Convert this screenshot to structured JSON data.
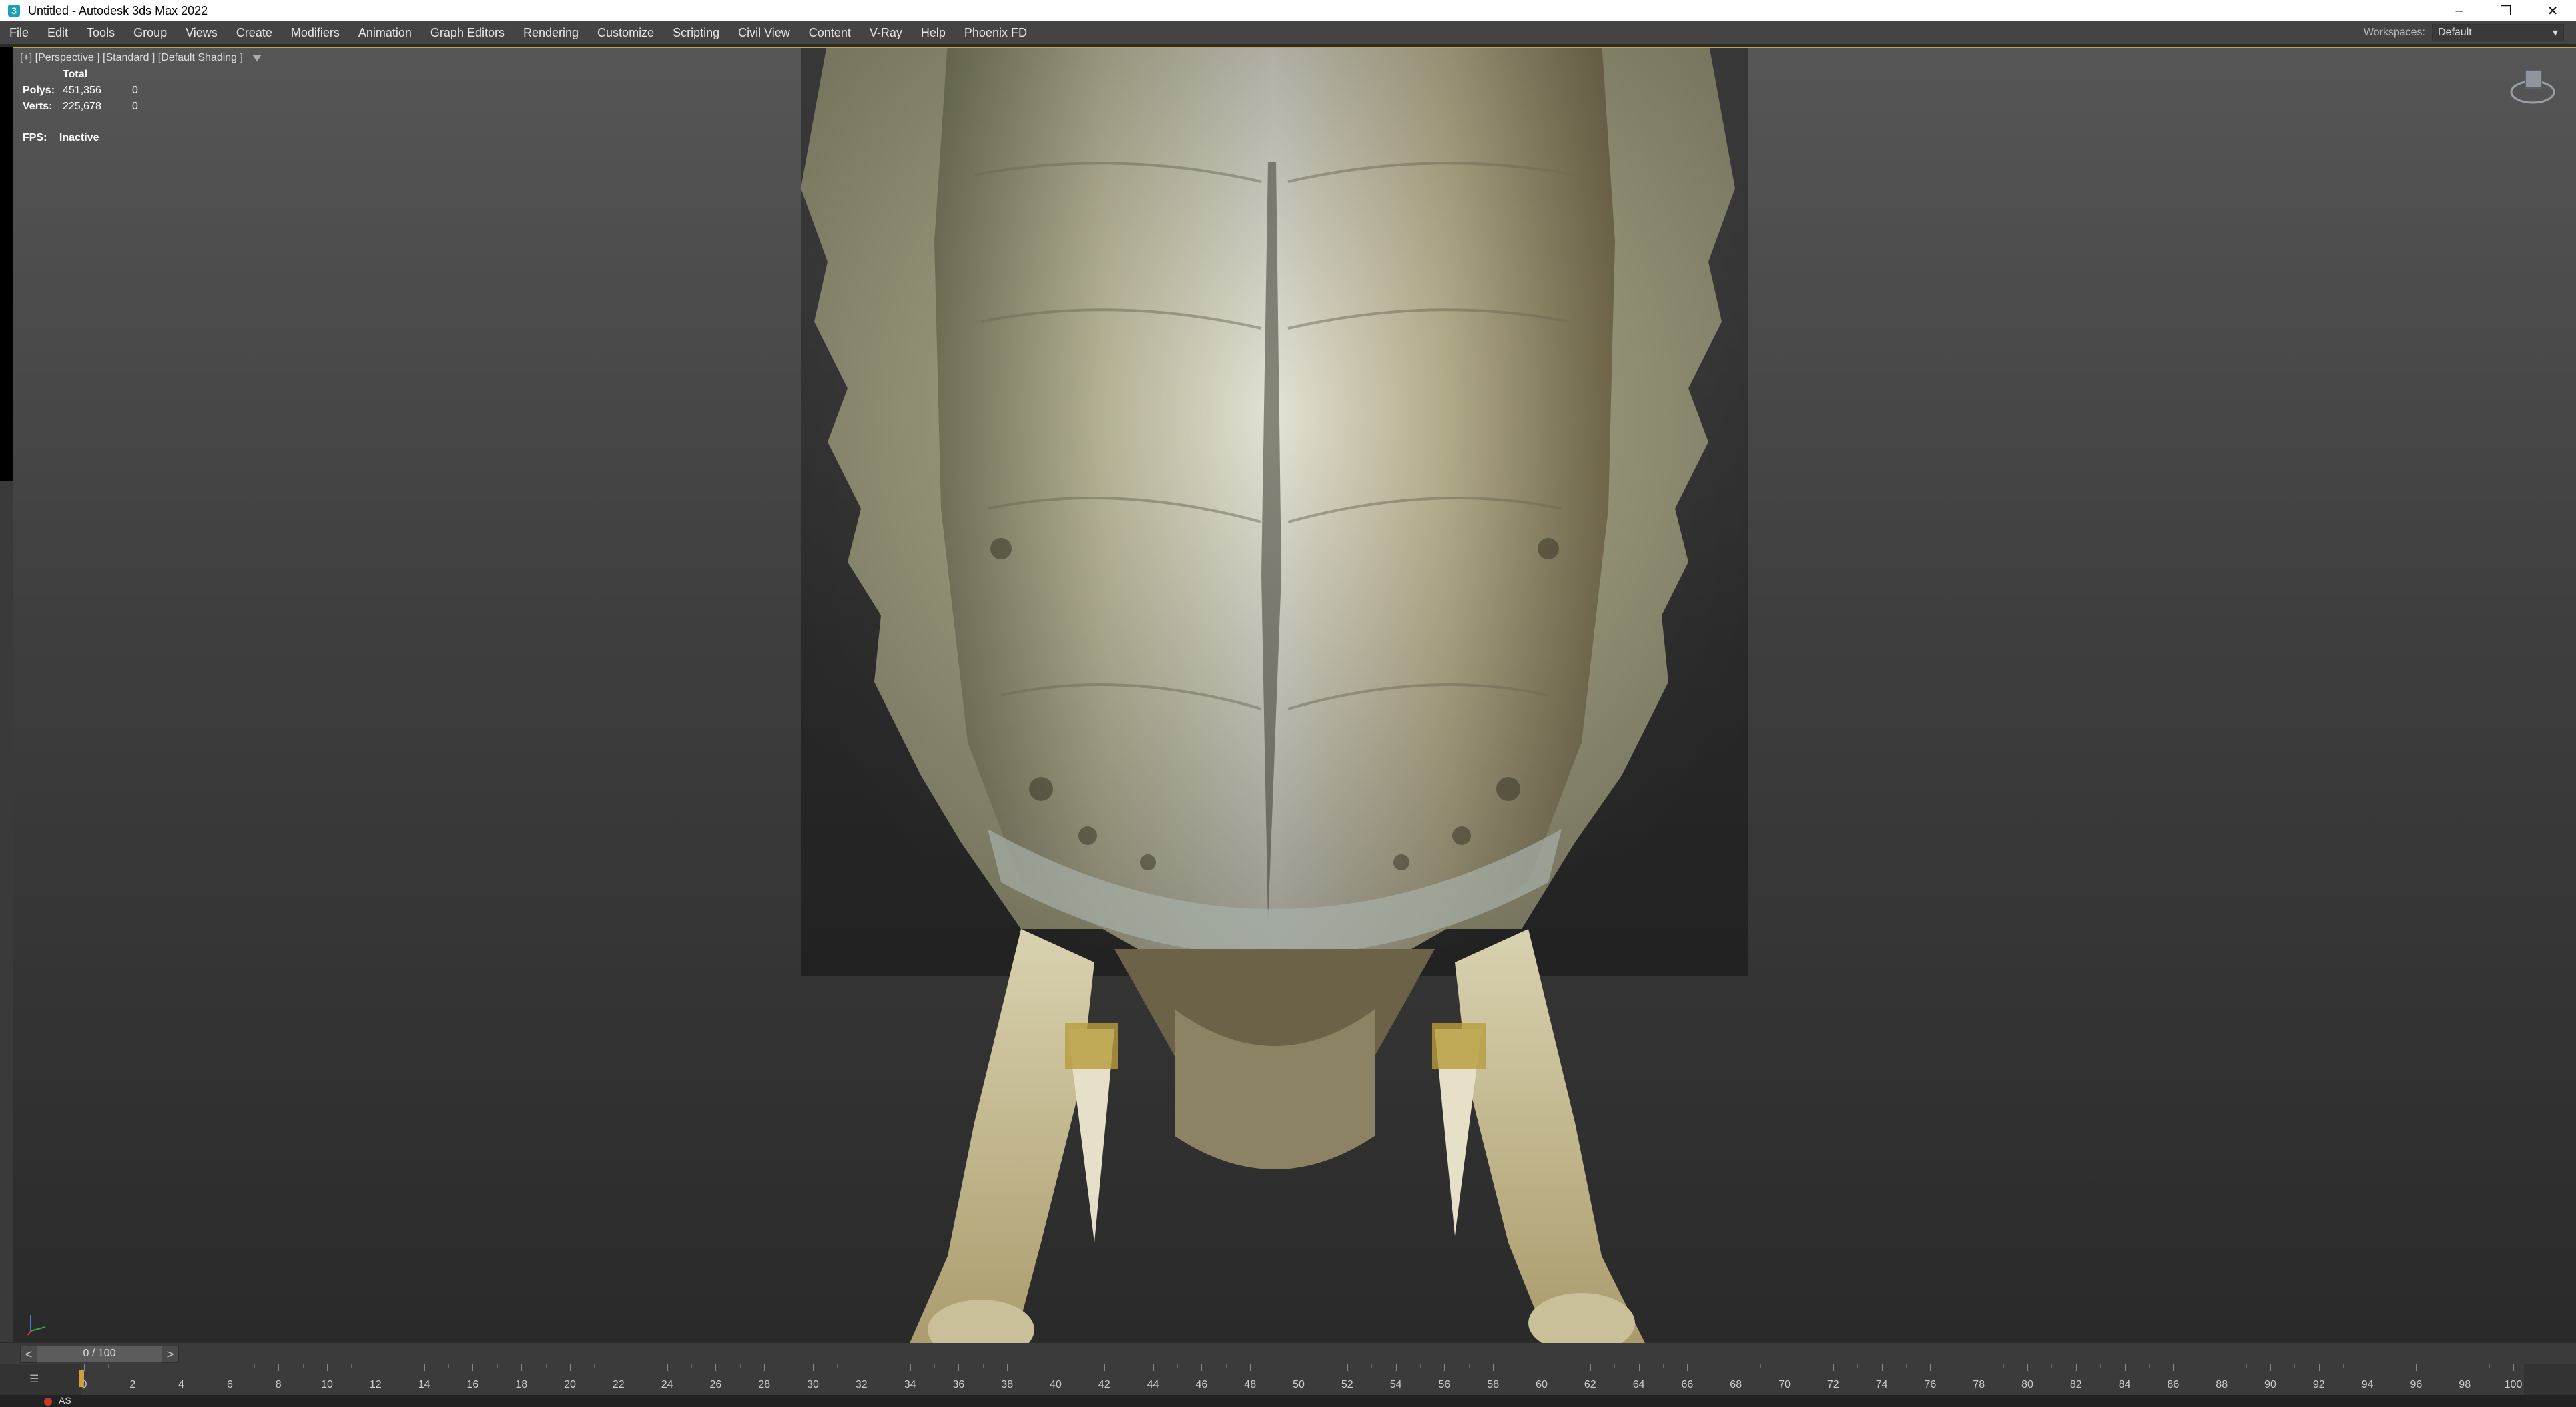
{
  "window": {
    "title": "Untitled - Autodesk 3ds Max 2022",
    "app_icon": "3",
    "controls": [
      "minimize-icon",
      "restore-icon",
      "close-icon"
    ]
  },
  "menu": {
    "items": [
      "File",
      "Edit",
      "Tools",
      "Group",
      "Views",
      "Create",
      "Modifiers",
      "Animation",
      "Graph Editors",
      "Rendering",
      "Customize",
      "Scripting",
      "Civil View",
      "Content",
      "V-Ray",
      "Help",
      "Phoenix FD"
    ],
    "workspaces_label": "Workspaces:",
    "workspaces_value": "Default"
  },
  "viewport": {
    "label": "[+] [Perspective ] [Standard ] [Default Shading ]",
    "stats": {
      "header": "Total",
      "polys_label": "Polys:",
      "polys_total": "451,356",
      "polys_sel": "0",
      "verts_label": "Verts:",
      "verts_total": "225,678",
      "verts_sel": "0"
    },
    "fps_label": "FPS:",
    "fps_value": "Inactive"
  },
  "timeline": {
    "frame_display": "0 / 100",
    "prev": "<",
    "next": ">",
    "current_frame": 0,
    "tick_labels": [
      "0",
      "2",
      "4",
      "6",
      "8",
      "10",
      "12",
      "14",
      "16",
      "18",
      "20",
      "22",
      "24",
      "26",
      "28",
      "30",
      "32",
      "34",
      "36",
      "38",
      "40",
      "42",
      "44",
      "46",
      "48",
      "50",
      "52",
      "54",
      "56",
      "58",
      "60",
      "62",
      "64",
      "66",
      "68",
      "70",
      "72",
      "74",
      "76",
      "78",
      "80",
      "82",
      "84",
      "86",
      "88",
      "90",
      "92",
      "94",
      "96",
      "98",
      "100"
    ]
  },
  "statusbar": {
    "script_label": "AS"
  },
  "colors": {
    "accent": "#c8a23c",
    "background": "#2b2b2b",
    "menubar": "#444444"
  }
}
